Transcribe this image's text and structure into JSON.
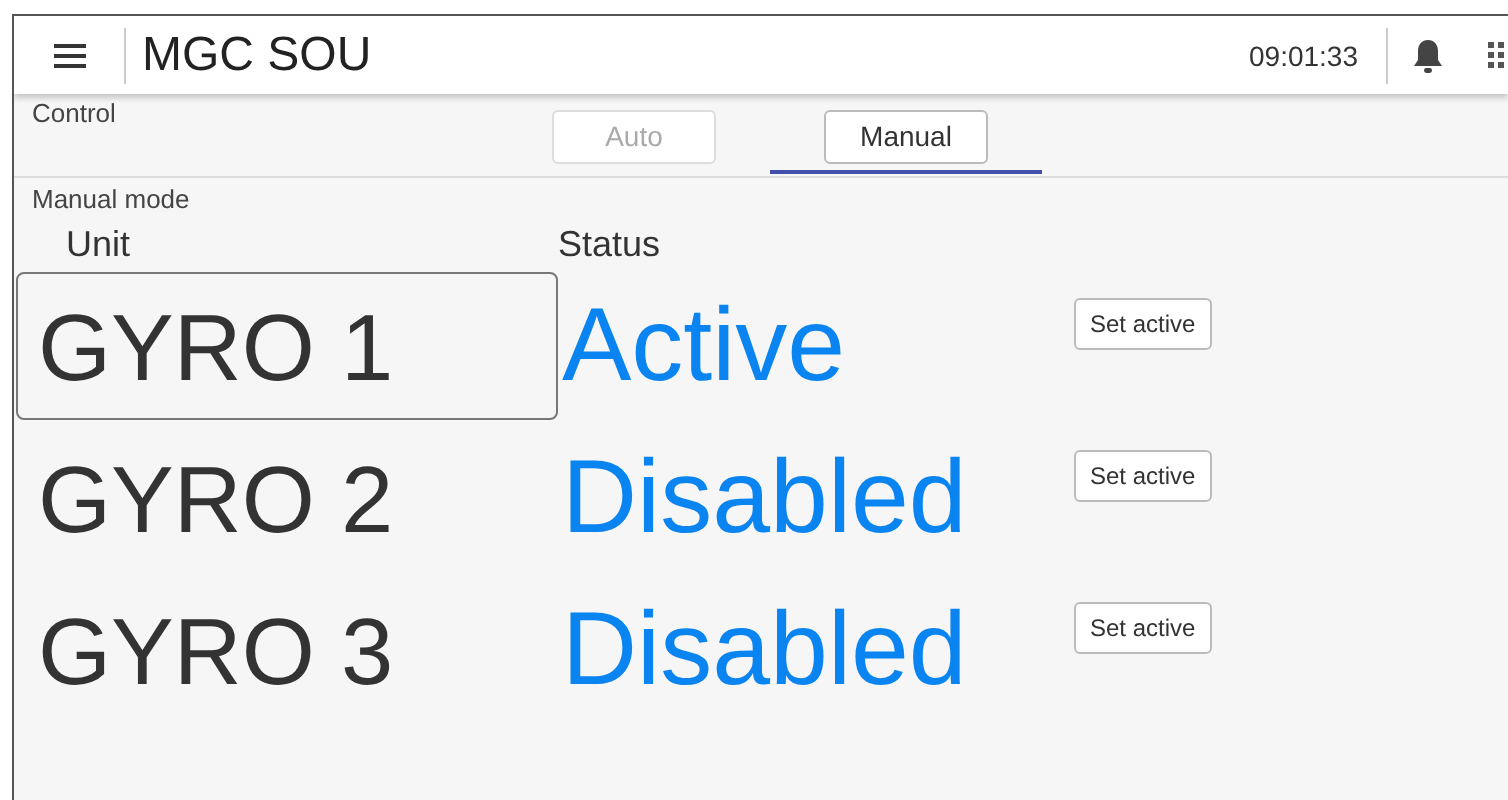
{
  "header": {
    "title": "MGC SOU",
    "time": "09:01:33"
  },
  "control": {
    "label": "Control",
    "tabs": [
      {
        "label": "Auto",
        "selected": false,
        "disabled": true
      },
      {
        "label": "Manual",
        "selected": true,
        "disabled": false
      }
    ]
  },
  "manual": {
    "label": "Manual mode",
    "columns": [
      "Unit",
      "Status"
    ],
    "rows": [
      {
        "unit": "GYRO 1",
        "status": "Active",
        "selected": true,
        "button": "Set active"
      },
      {
        "unit": "GYRO 2",
        "status": "Disabled",
        "selected": false,
        "button": "Set active"
      },
      {
        "unit": "GYRO 3",
        "status": "Disabled",
        "selected": false,
        "button": "Set active"
      }
    ]
  }
}
